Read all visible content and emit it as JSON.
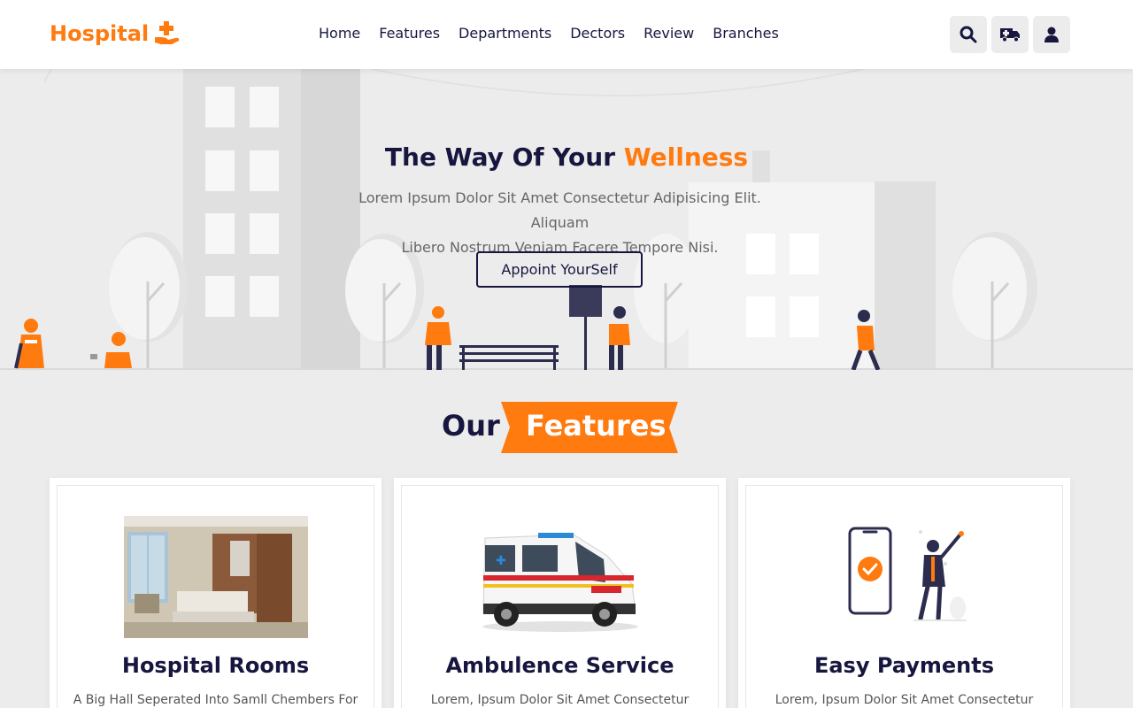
{
  "header": {
    "logo_text": "Hospital",
    "nav": [
      "Home",
      "Features",
      "Departments",
      "Dectors",
      "Review",
      "Branches"
    ],
    "icons": [
      "search-icon",
      "ambulance-icon",
      "user-icon"
    ]
  },
  "hero": {
    "title_main": "The Way Of Your ",
    "title_accent": "Wellness",
    "text_line1": "Lorem Ipsum Dolor Sit Amet Consectetur Adipisicing Elit. Aliquam",
    "text_line2": "Libero Nostrum Veniam Facere Tempore Nisi.",
    "button_label": "Appoint YourSelf"
  },
  "features": {
    "heading_our": "Our",
    "heading_features": "Features",
    "cards": [
      {
        "title": "Hospital Rooms",
        "text": "A Big Hall Seperated Into Samll Chembers For"
      },
      {
        "title": "Ambulence Service",
        "text": "Lorem, Ipsum Dolor Sit Amet Consectetur"
      },
      {
        "title": "Easy Payments",
        "text": "Lorem, Ipsum Dolor Sit Amet Consectetur"
      }
    ]
  },
  "colors": {
    "accent": "#ff7a0f",
    "dark": "#16163f",
    "background": "#ececec"
  }
}
